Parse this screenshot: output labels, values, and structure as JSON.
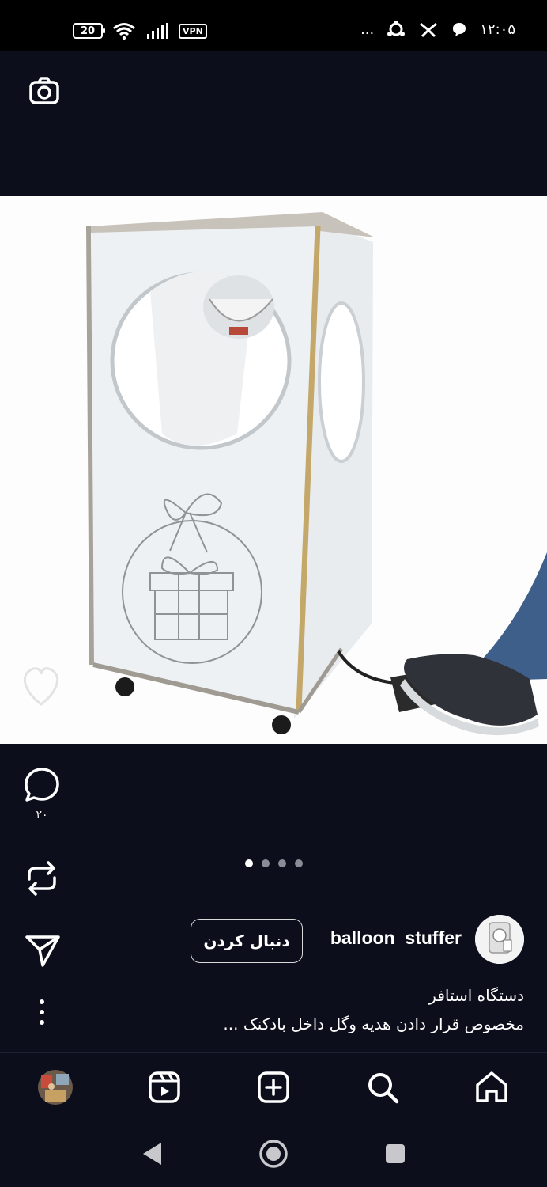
{
  "status_bar": {
    "battery": "20",
    "vpn": "VPN",
    "more": "...",
    "time": "۱۲:۰۵"
  },
  "post": {
    "comment_count": "۲۰",
    "carousel": {
      "total": 4,
      "active": 0
    },
    "username": "balloon_stuffer",
    "follow_label": "دنبال کردن",
    "caption_line1": "دستگاه استافر",
    "caption_line2": "مخصوص قرار دادن هدیه وگل داخل بادکنک ..."
  },
  "icons": {
    "camera": "camera-icon",
    "like": "heart-icon",
    "comment": "comment-icon",
    "repost": "repost-icon",
    "share": "send-icon",
    "more": "more-vertical-icon",
    "nav": [
      "profile-avatar",
      "reels-icon",
      "create-icon",
      "search-icon",
      "home-icon"
    ]
  },
  "colors": {
    "background": "#0c0f1b",
    "text": "#ffffff",
    "dot_inactive": "#8a8d96"
  }
}
